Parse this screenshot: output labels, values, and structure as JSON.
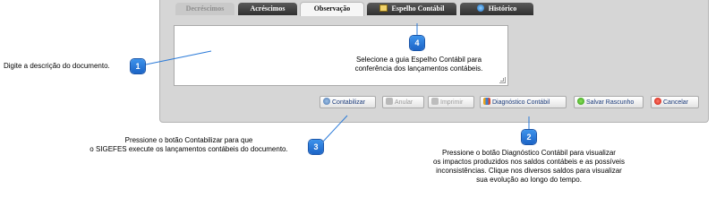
{
  "tabs": {
    "decrescimos": "Decréscimos",
    "acrescimos": "Acréscimos",
    "observacao": "Observação",
    "espelho": "Espelho Contábil",
    "historico": "Histórico"
  },
  "buttons": {
    "contabilizar": "Contabilizar",
    "anular": "Anular",
    "imprimir": "Imprimir",
    "diagnostico": "Diagnóstico Contábil",
    "salvar": "Salvar Rascunho",
    "cancelar": "Cancelar"
  },
  "badges": [
    "1",
    "2",
    "3",
    "4"
  ],
  "callouts": {
    "c1": "Digite a descrição do documento.",
    "c4_line1": "Selecione a guia Espelho Contábil para",
    "c4_line2": "conferência dos lançamentos contábeis.",
    "c3_line1": "Pressione o botão Contabilizar para que",
    "c3_line2": "o SIGEFES execute os lançamentos contábeis do documento.",
    "c2_line1": "Pressione o botão Diagnóstico Contábil para visualizar",
    "c2_line2": "os impactos produzidos nos saldos contábeis e as possíveis",
    "c2_line3": "inconsistências. Clique nos diversos saldos para visualizar",
    "c2_line4": "sua evolução ao longo do tempo."
  },
  "colors": {
    "badge": "#2a7ad8",
    "accent": "#1a3a7a",
    "tab_dark": "#3b3b3b"
  }
}
